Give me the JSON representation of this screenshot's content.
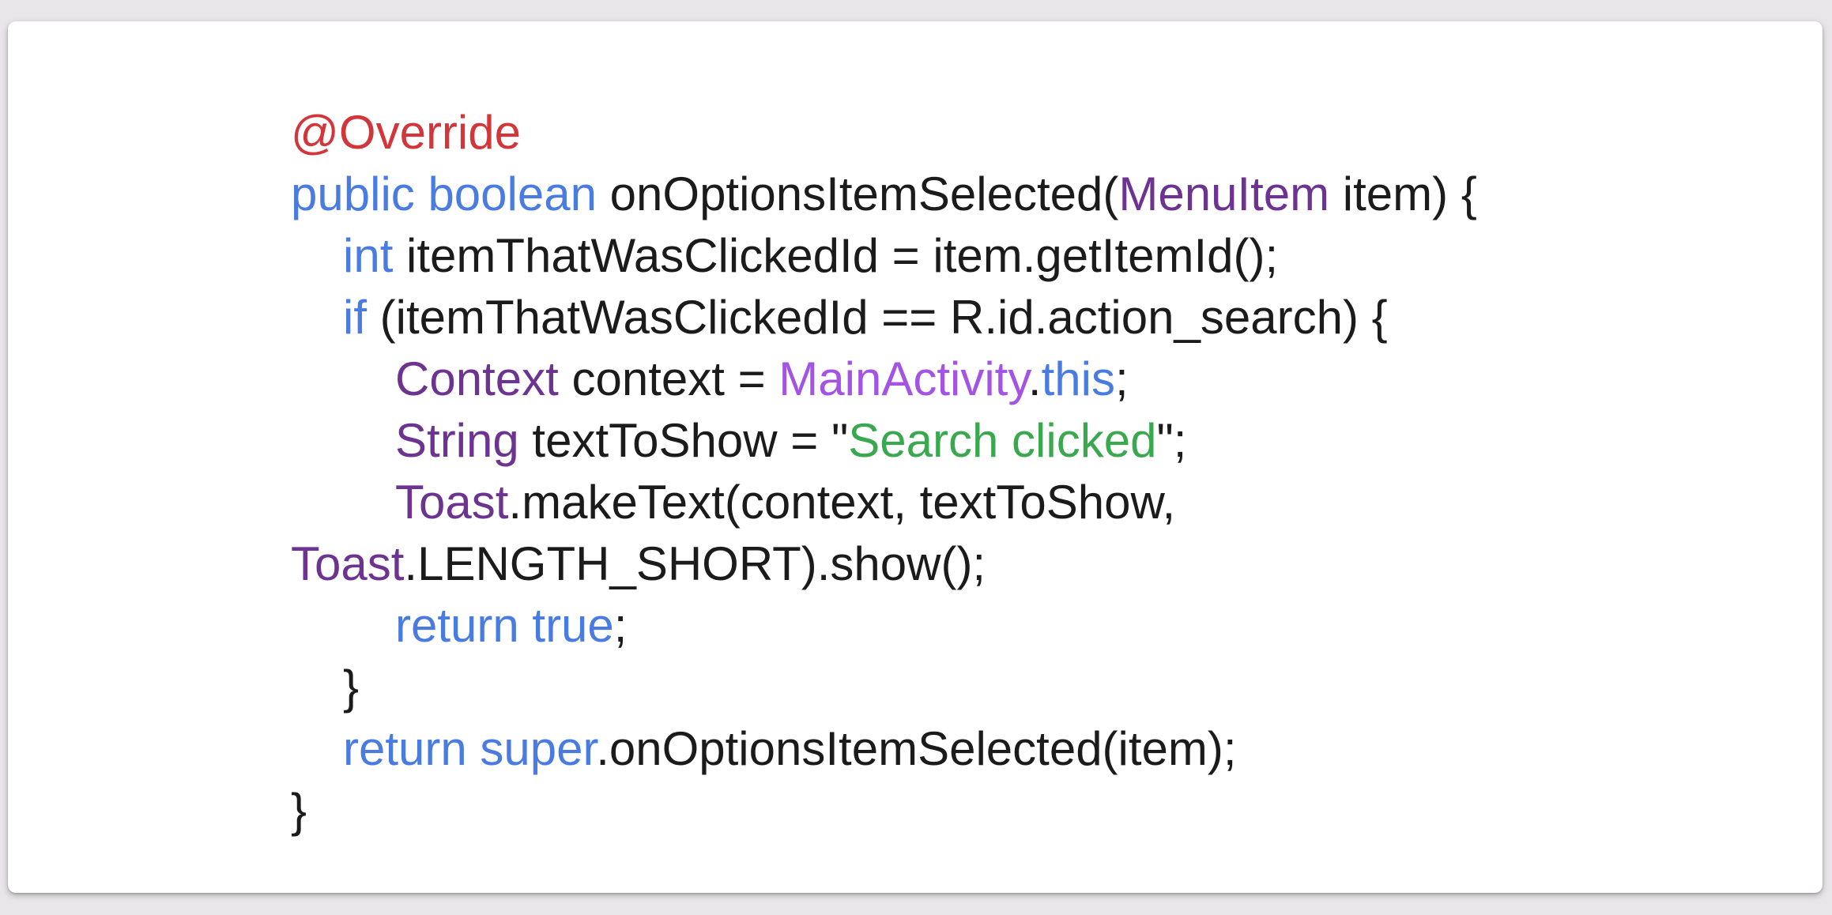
{
  "slide": {
    "colors": {
      "background": "#e8e6e8",
      "card": "#ffffff",
      "annotation": "#d2353a",
      "keyword": "#4a7be0",
      "type": "#6c3391",
      "class_ref": "#a354e2",
      "string": "#3aa84f",
      "plain": "#1b1b1b"
    },
    "code_lines": [
      {
        "indent": 0,
        "tokens": [
          {
            "kind": "annotation",
            "text": "@Override"
          }
        ]
      },
      {
        "indent": 0,
        "tokens": [
          {
            "kind": "keyword",
            "text": "public boolean"
          },
          {
            "kind": "plain",
            "text": " onOptionsItemSelected("
          },
          {
            "kind": "type",
            "text": "MenuItem"
          },
          {
            "kind": "plain",
            "text": " item) {"
          }
        ]
      },
      {
        "indent": 1,
        "tokens": [
          {
            "kind": "keyword",
            "text": "int"
          },
          {
            "kind": "plain",
            "text": " itemThatWasClickedId = item.getItemId();"
          }
        ]
      },
      {
        "indent": 1,
        "tokens": [
          {
            "kind": "keyword",
            "text": "if"
          },
          {
            "kind": "plain",
            "text": " (itemThatWasClickedId == R.id.action_search) {"
          }
        ]
      },
      {
        "indent": 2,
        "tokens": [
          {
            "kind": "type",
            "text": "Context"
          },
          {
            "kind": "plain",
            "text": " context = "
          },
          {
            "kind": "class-ref",
            "text": "MainActivity"
          },
          {
            "kind": "plain",
            "text": "."
          },
          {
            "kind": "keyword",
            "text": "this"
          },
          {
            "kind": "plain",
            "text": ";"
          }
        ]
      },
      {
        "indent": 2,
        "tokens": [
          {
            "kind": "type",
            "text": "String"
          },
          {
            "kind": "plain",
            "text": " textToShow = \""
          },
          {
            "kind": "string",
            "text": "Search clicked"
          },
          {
            "kind": "plain",
            "text": "\";"
          }
        ]
      },
      {
        "indent": 2,
        "tokens": [
          {
            "kind": "type",
            "text": "Toast"
          },
          {
            "kind": "plain",
            "text": ".makeText(context, textToShow,"
          }
        ]
      },
      {
        "indent": 0,
        "tokens": [
          {
            "kind": "type",
            "text": "Toast"
          },
          {
            "kind": "plain",
            "text": ".LENGTH_SHORT).show();"
          }
        ]
      },
      {
        "indent": 2,
        "tokens": [
          {
            "kind": "keyword",
            "text": "return true"
          },
          {
            "kind": "plain",
            "text": ";"
          }
        ]
      },
      {
        "indent": 1,
        "tokens": [
          {
            "kind": "plain",
            "text": "}"
          }
        ]
      },
      {
        "indent": 1,
        "tokens": [
          {
            "kind": "keyword",
            "text": "return super"
          },
          {
            "kind": "plain",
            "text": ".onOptionsItemSelected(item);"
          }
        ]
      },
      {
        "indent": 0,
        "tokens": [
          {
            "kind": "plain",
            "text": "}"
          }
        ]
      }
    ]
  }
}
